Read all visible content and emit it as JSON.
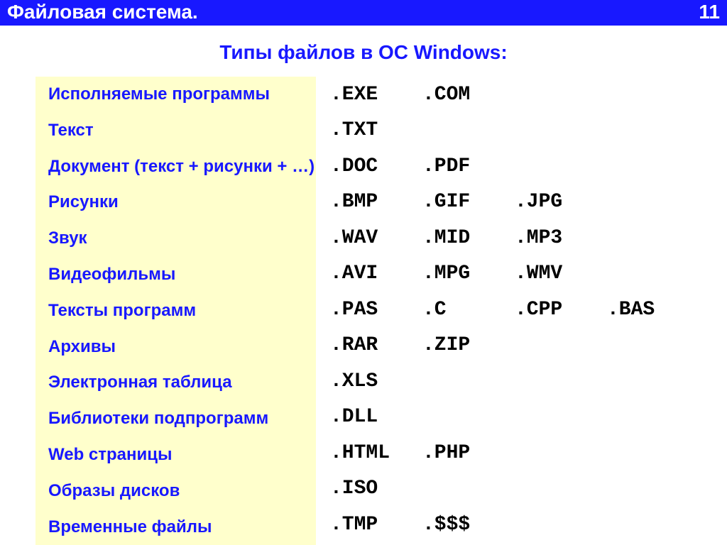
{
  "header": {
    "title": "Файловая система.",
    "page_number": "11"
  },
  "subtitle": "Типы файлов в ОС Windows:",
  "rows": [
    {
      "category": "Исполняемые программы",
      "extensions": [
        ".exe",
        ".com"
      ]
    },
    {
      "category": "Текст",
      "extensions": [
        ".txt"
      ]
    },
    {
      "category": "Документ (текст + рисунки + …)",
      "extensions": [
        ".doc",
        ".pdf"
      ]
    },
    {
      "category": "Рисунки",
      "extensions": [
        ".bmp",
        ".gif",
        ".jpg"
      ]
    },
    {
      "category": "Звук",
      "extensions": [
        ".wav",
        ".mid",
        ".mp3"
      ]
    },
    {
      "category": "Видеофильмы",
      "extensions": [
        ".avi",
        ".mpg",
        ".wmv"
      ]
    },
    {
      "category": "Тексты программ",
      "extensions": [
        ".pas",
        ".c",
        ".cpp",
        ".bas"
      ]
    },
    {
      "category": "Архивы",
      "extensions": [
        ".rar",
        ".zip"
      ]
    },
    {
      "category": "Электронная таблица",
      "extensions": [
        ".xls"
      ]
    },
    {
      "category": "Библиотеки подпрограмм",
      "extensions": [
        ".dll"
      ]
    },
    {
      "category": "Web страницы",
      "extensions": [
        ".html",
        ".php"
      ]
    },
    {
      "category": "Образы дисков",
      "extensions": [
        ".iso"
      ]
    },
    {
      "category": "Временные файлы",
      "extensions": [
        ".tmp",
        ".$$$"
      ]
    }
  ]
}
